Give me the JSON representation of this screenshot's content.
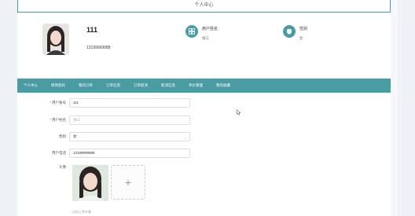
{
  "page": {
    "title": "个人中心"
  },
  "profile": {
    "username": "111",
    "phone": "13199999888",
    "name_label": "用户姓名",
    "name_value": "张三",
    "gender_label": "性别",
    "gender_value": "女"
  },
  "nav": {
    "items": [
      "个人中心",
      "修改密码",
      "我的订单",
      "订单信息",
      "订单取消",
      "取消信息",
      "评价管理",
      "我的收藏"
    ]
  },
  "form": {
    "account_label": "用户账号",
    "account_value": "111",
    "name_label": "用户姓名",
    "name_value": "张三",
    "gender_label": "性别",
    "gender_value": "女",
    "phone_label": "用户电话",
    "phone_value": "13199999888",
    "avatar_label": "头像",
    "upload_plus": "+",
    "upload_hint": "点击上传头像"
  },
  "icons": {
    "name_icon": "user-grid-icon",
    "gender_icon": "shield-icon",
    "dropdown": "chevron-down-icon"
  },
  "colors": {
    "accent": "#4a9ca3",
    "required": "#e55555"
  }
}
